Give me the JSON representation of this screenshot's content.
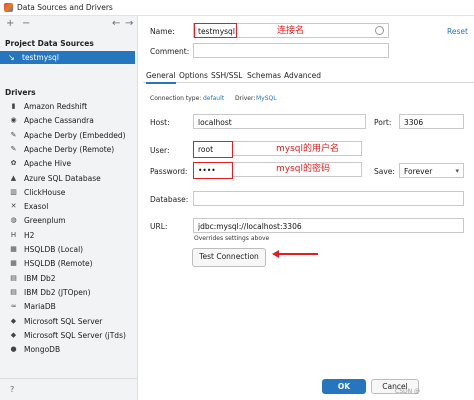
{
  "window": {
    "title": "Data Sources and Drivers"
  },
  "left": {
    "project_section": "Project Data Sources",
    "project_item": "testmysql",
    "drivers_section": "Drivers",
    "drivers": [
      {
        "label": "Amazon Redshift",
        "icon": "redshift-icon"
      },
      {
        "label": "Apache Cassandra",
        "icon": "cassandra-icon"
      },
      {
        "label": "Apache Derby (Embedded)",
        "icon": "derby-icon"
      },
      {
        "label": "Apache Derby (Remote)",
        "icon": "derby-icon"
      },
      {
        "label": "Apache Hive",
        "icon": "hive-icon"
      },
      {
        "label": "Azure SQL Database",
        "icon": "azure-icon"
      },
      {
        "label": "ClickHouse",
        "icon": "clickhouse-icon"
      },
      {
        "label": "Exasol",
        "icon": "exasol-icon"
      },
      {
        "label": "Greenplum",
        "icon": "greenplum-icon"
      },
      {
        "label": "H2",
        "icon": "h2-icon"
      },
      {
        "label": "HSQLDB (Local)",
        "icon": "hsqldb-icon"
      },
      {
        "label": "HSQLDB (Remote)",
        "icon": "hsqldb-icon"
      },
      {
        "label": "IBM Db2",
        "icon": "db2-icon"
      },
      {
        "label": "IBM Db2 (JTOpen)",
        "icon": "db2-icon"
      },
      {
        "label": "MariaDB",
        "icon": "mariadb-icon"
      },
      {
        "label": "Microsoft SQL Server",
        "icon": "sqlserver-icon"
      },
      {
        "label": "Microsoft SQL Server (jTds)",
        "icon": "sqlserver-icon"
      },
      {
        "label": "MongoDB",
        "icon": "mongodb-icon"
      }
    ],
    "toolbar": {
      "add": "+",
      "remove": "−",
      "back": "←",
      "forward": "→"
    }
  },
  "form": {
    "name_label": "Name:",
    "name_value": "testmysql",
    "reset": "Reset",
    "comment_label": "Comment:",
    "tabs": [
      "General",
      "Options",
      "SSH/SSL",
      "Schemas",
      "Advanced"
    ],
    "connection_type_label": "Connection type:",
    "connection_type_value": "default",
    "driver_label": "Driver:",
    "driver_value": "MySQL",
    "host_label": "Host:",
    "host_value": "localhost",
    "port_label": "Port:",
    "port_value": "3306",
    "user_label": "User:",
    "user_value": "root",
    "password_label": "Password:",
    "password_value": "••••",
    "save_label": "Save:",
    "save_value": "Forever",
    "database_label": "Database:",
    "database_value": "",
    "url_label": "URL:",
    "url_value": "jdbc:mysql://localhost:3306",
    "overrides_note": "Overrides settings above",
    "test_connection": "Test Connection",
    "ok": "OK",
    "cancel": "Cancel",
    "watermark": "CSDN @"
  },
  "annotations": {
    "name_note": "连接名",
    "user_note": "mysql的用户名",
    "password_note": "mysql的密码"
  },
  "colors": {
    "accent": "#2675bf",
    "annotation": "#e02020"
  }
}
